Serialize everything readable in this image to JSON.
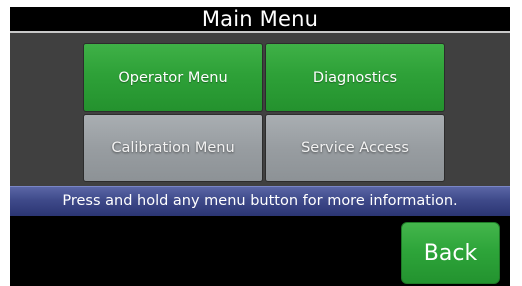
{
  "header": {
    "title": "Main Menu"
  },
  "menu": {
    "buttons": [
      {
        "label": "Operator Menu",
        "state": "enabled"
      },
      {
        "label": "Diagnostics",
        "state": "enabled"
      },
      {
        "label": "Calibration Menu",
        "state": "disabled"
      },
      {
        "label": "Service Access",
        "state": "disabled"
      }
    ]
  },
  "info_bar": {
    "text": "Press and hold any menu button for more information."
  },
  "footer": {
    "back_label": "Back"
  },
  "colors": {
    "background": "#000000",
    "menu_panel": "#404040",
    "enabled_button": "#2ea138",
    "disabled_button": "#989da1",
    "info_bar": "#3f4a8a"
  }
}
